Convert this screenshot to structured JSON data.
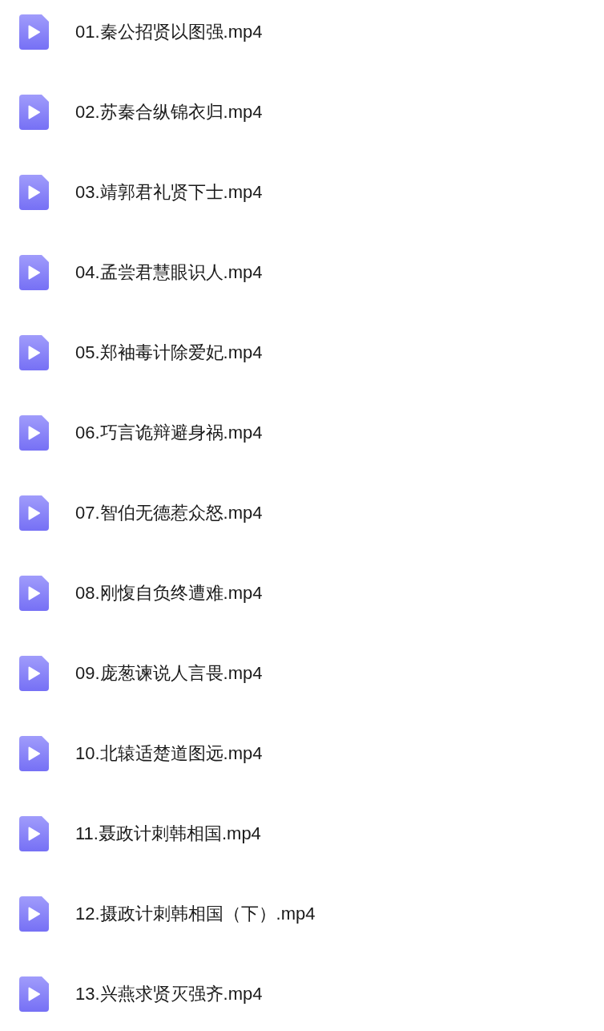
{
  "files": [
    {
      "name": "01.秦公招贤以图强.mp4"
    },
    {
      "name": "02.苏秦合纵锦衣归.mp4"
    },
    {
      "name": "03.靖郭君礼贤下士.mp4"
    },
    {
      "name": "04.孟尝君慧眼识人.mp4"
    },
    {
      "name": "05.郑袖毒计除爱妃.mp4"
    },
    {
      "name": "06.巧言诡辩避身祸.mp4"
    },
    {
      "name": "07.智伯无德惹众怒.mp4"
    },
    {
      "name": "08.刚愎自负终遭难.mp4"
    },
    {
      "name": "09.庞葱谏说人言畏.mp4"
    },
    {
      "name": "10.北辕适楚道图远.mp4"
    },
    {
      "name": "11.聂政计刺韩相国.mp4"
    },
    {
      "name": "12.摄政计刺韩相国（下）.mp4"
    },
    {
      "name": "13.兴燕求贤灭强齐.mp4"
    }
  ]
}
